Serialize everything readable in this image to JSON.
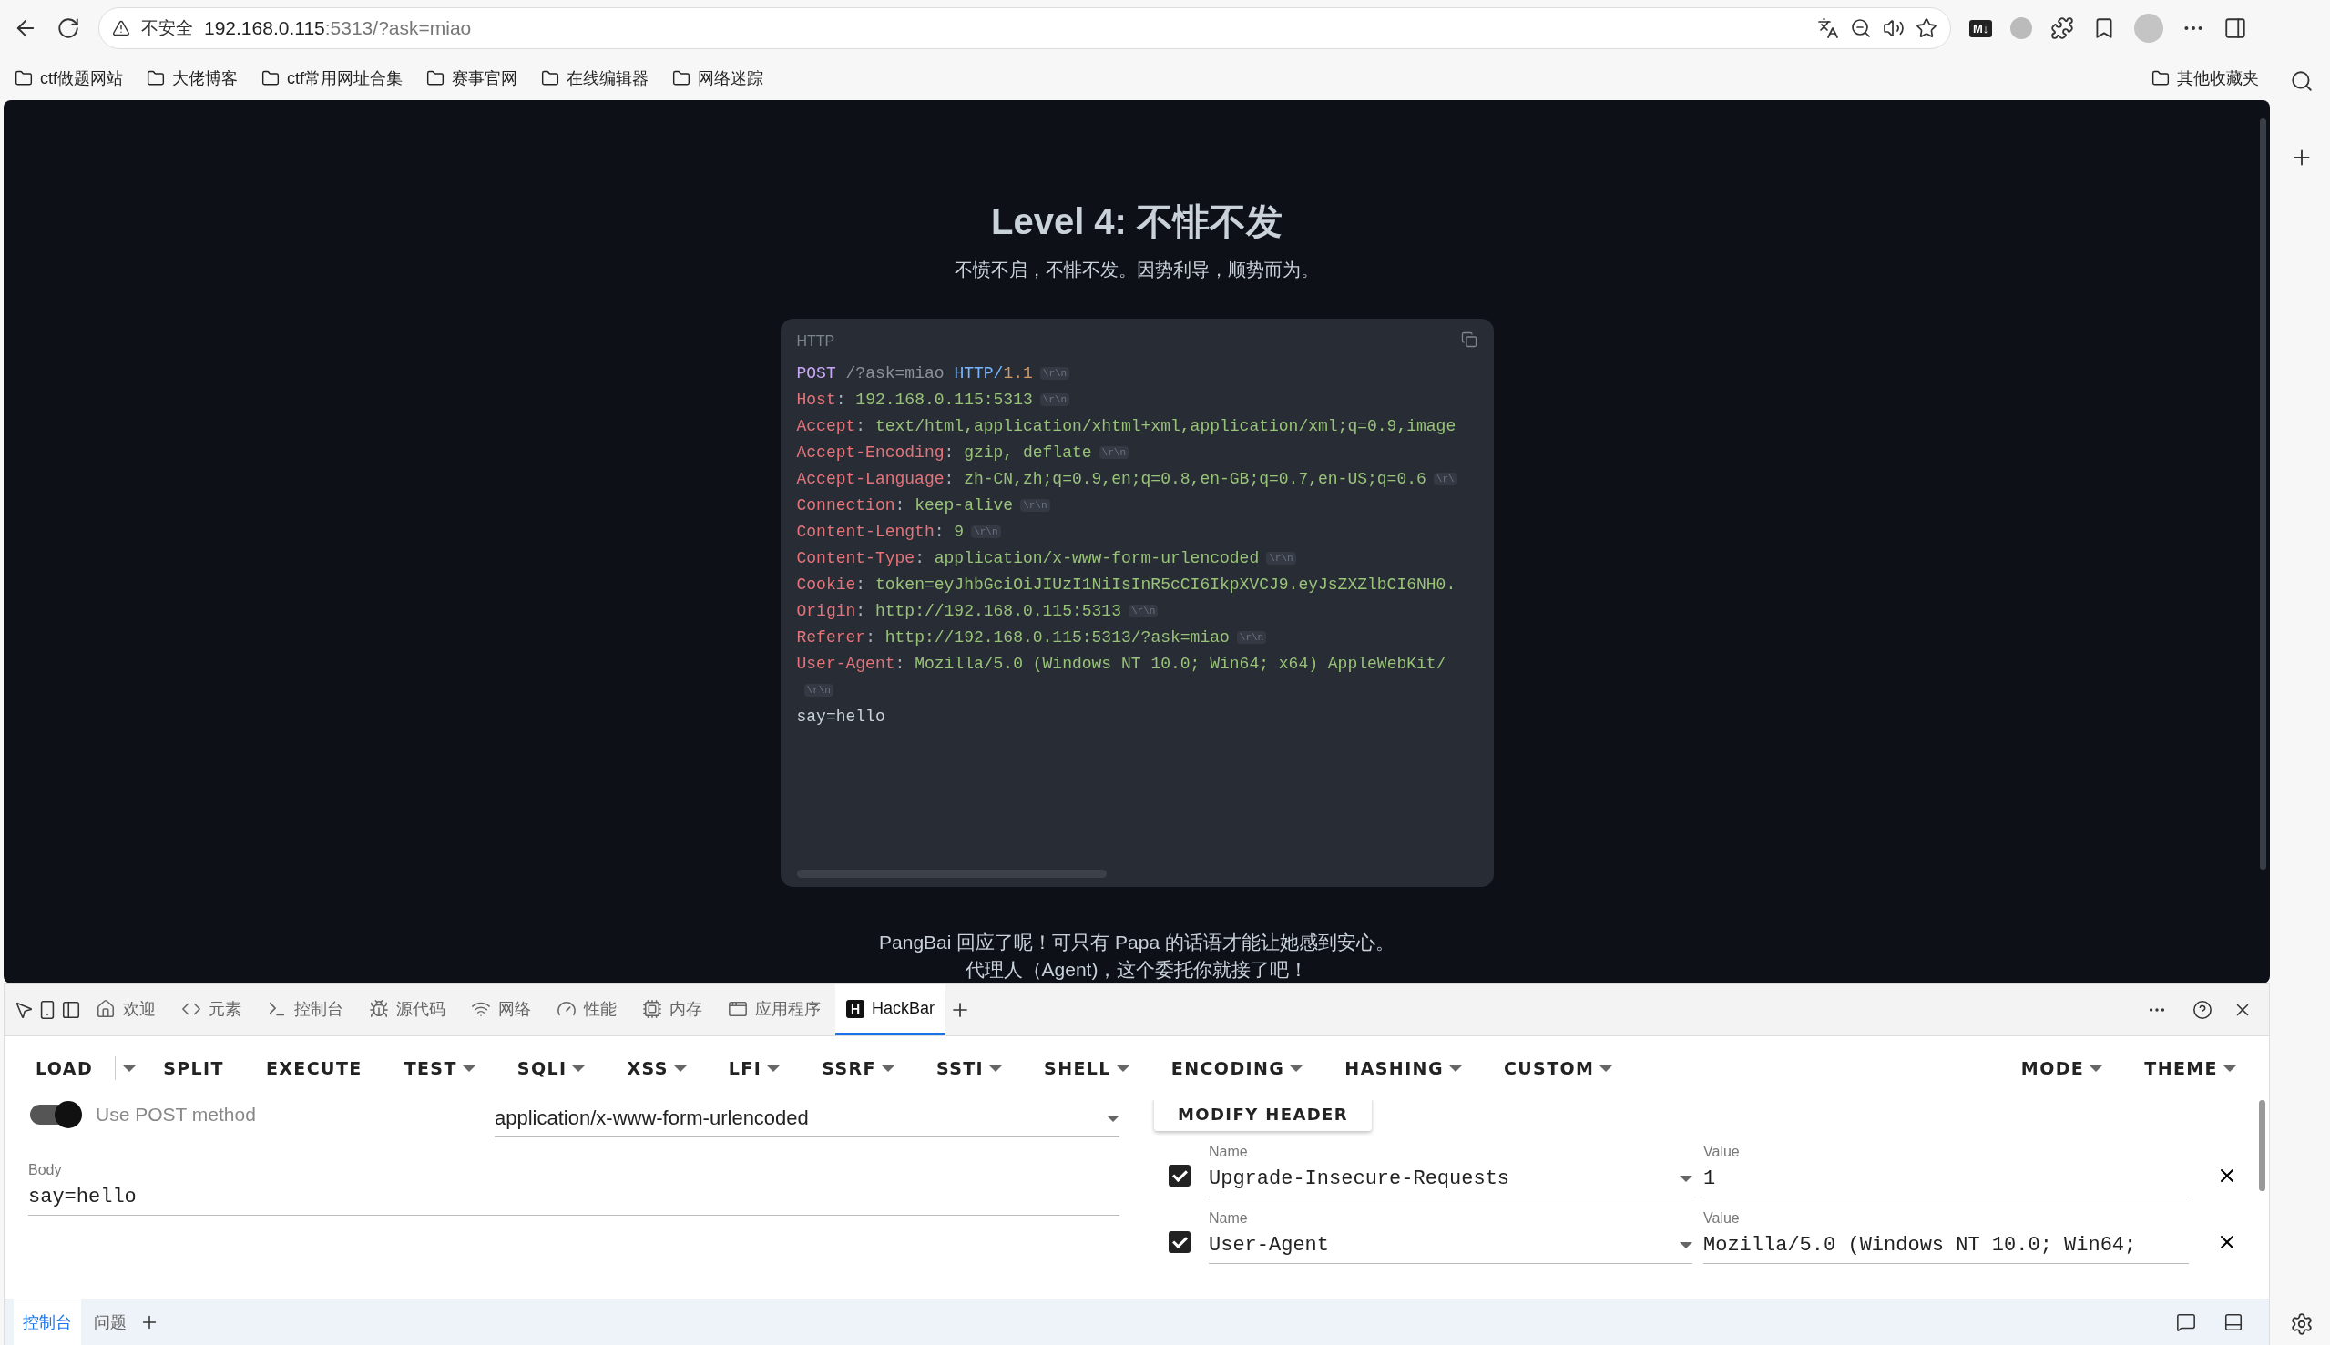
{
  "browser": {
    "address": {
      "security": "不安全",
      "host": "192.168.0.115",
      "path": ":5313/?ask=miao"
    },
    "extension_badge": "M↓",
    "bookmarks": [
      {
        "label": "ctf做题网站"
      },
      {
        "label": "大佬博客"
      },
      {
        "label": "ctf常用网址合集"
      },
      {
        "label": "赛事官网"
      },
      {
        "label": "在线编辑器"
      },
      {
        "label": "网络迷踪"
      }
    ],
    "other_bookmarks": "其他收藏夹"
  },
  "page": {
    "title": "Level 4: 不悱不发",
    "subtitle": "不愤不启，不悱不发。因势利导，顺势而为。",
    "http_block": {
      "label": "HTTP",
      "lines": [
        {
          "kind": "request",
          "method": "POST",
          "path": "/?ask=miao",
          "protocol": "HTTP/",
          "version": "1.1",
          "crlf": "\\r\\n"
        },
        {
          "kind": "header",
          "name": "Host",
          "sep": ": ",
          "value": "192.168.0.115:5313",
          "crlf": "\\r\\n"
        },
        {
          "kind": "header",
          "name": "Accept",
          "sep": ": ",
          "value": "text/html,application/xhtml+xml,application/xml;q=0.9,image"
        },
        {
          "kind": "header",
          "name": "Accept-Encoding",
          "sep": ": ",
          "value": "gzip, deflate",
          "crlf": "\\r\\n"
        },
        {
          "kind": "header",
          "name": "Accept-Language",
          "sep": ": ",
          "value": "zh-CN,zh;q=0.9,en;q=0.8,en-GB;q=0.7,en-US;q=0.6",
          "crlf": "\\r\\"
        },
        {
          "kind": "header",
          "name": "Connection",
          "sep": ": ",
          "value": "keep-alive",
          "crlf": "\\r\\n"
        },
        {
          "kind": "header",
          "name": "Content-Length",
          "sep": ": ",
          "value": "9",
          "crlf": "\\r\\n"
        },
        {
          "kind": "header",
          "name": "Content-Type",
          "sep": ": ",
          "value": "application/x-www-form-urlencoded",
          "crlf": "\\r\\n"
        },
        {
          "kind": "header",
          "name": "Cookie",
          "sep": ": ",
          "value": "token=eyJhbGciOiJIUzI1NiIsInR5cCI6IkpXVCJ9.eyJsZXZlbCI6NH0."
        },
        {
          "kind": "header",
          "name": "Origin",
          "sep": ": ",
          "value": "http://192.168.0.115:5313",
          "crlf": "\\r\\n"
        },
        {
          "kind": "header",
          "name": "Referer",
          "sep": ": ",
          "value": "http://192.168.0.115:5313/?ask=miao",
          "crlf": "\\r\\n"
        },
        {
          "kind": "header",
          "name": "User-Agent",
          "sep": ": ",
          "value": "Mozilla/5.0 (Windows NT 10.0; Win64; x64) AppleWebKit/"
        },
        {
          "kind": "crlf",
          "crlf": "\\r\\n"
        },
        {
          "kind": "body",
          "text": "say=hello"
        }
      ]
    },
    "messages": [
      "PangBai 回应了呢！可只有 Papa 的话语才能让她感到安心。",
      "代理人（Agent)，这个委托你就接了吧！"
    ]
  },
  "devtools": {
    "tabs": [
      {
        "label": "欢迎",
        "selected": false
      },
      {
        "label": "元素",
        "selected": false
      },
      {
        "label": "控制台",
        "selected": false
      },
      {
        "label": "源代码",
        "selected": false
      },
      {
        "label": "网络",
        "selected": false
      },
      {
        "label": "性能",
        "selected": false
      },
      {
        "label": "内存",
        "selected": false
      },
      {
        "label": "应用程序",
        "selected": false
      },
      {
        "label": "HackBar",
        "logo": "H",
        "selected": true
      }
    ],
    "hackbar": {
      "menu": [
        {
          "label": "LOAD",
          "dropdown": false,
          "split": true
        },
        {
          "label": "SPLIT",
          "dropdown": false
        },
        {
          "label": "EXECUTE",
          "dropdown": false
        },
        {
          "label": "TEST",
          "dropdown": true
        },
        {
          "label": "SQLI",
          "dropdown": true
        },
        {
          "label": "XSS",
          "dropdown": true
        },
        {
          "label": "LFI",
          "dropdown": true
        },
        {
          "label": "SSRF",
          "dropdown": true
        },
        {
          "label": "SSTI",
          "dropdown": true
        },
        {
          "label": "SHELL",
          "dropdown": true
        },
        {
          "label": "ENCODING",
          "dropdown": true
        },
        {
          "label": "HASHING",
          "dropdown": true
        },
        {
          "label": "CUSTOM",
          "dropdown": true
        }
      ],
      "menu_right": [
        {
          "label": "MODE",
          "dropdown": true
        },
        {
          "label": "THEME",
          "dropdown": true
        }
      ],
      "post_toggle": {
        "label": "Use POST method",
        "on": true
      },
      "content_type": "application/x-www-form-urlencoded",
      "body": {
        "label": "Body",
        "value": "say=hello"
      },
      "modify_header": "MODIFY HEADER",
      "headers": [
        {
          "enabled": true,
          "name_label": "Name",
          "name": "Upgrade-Insecure-Requests",
          "value_label": "Value",
          "value": "1"
        },
        {
          "enabled": true,
          "name_label": "Name",
          "name": "User-Agent",
          "value_label": "Value",
          "value": "Mozilla/5.0 (Windows NT 10.0; Win64;"
        }
      ]
    },
    "drawer_tabs": [
      {
        "label": "控制台",
        "selected": true
      },
      {
        "label": "问题",
        "selected": false
      }
    ]
  }
}
